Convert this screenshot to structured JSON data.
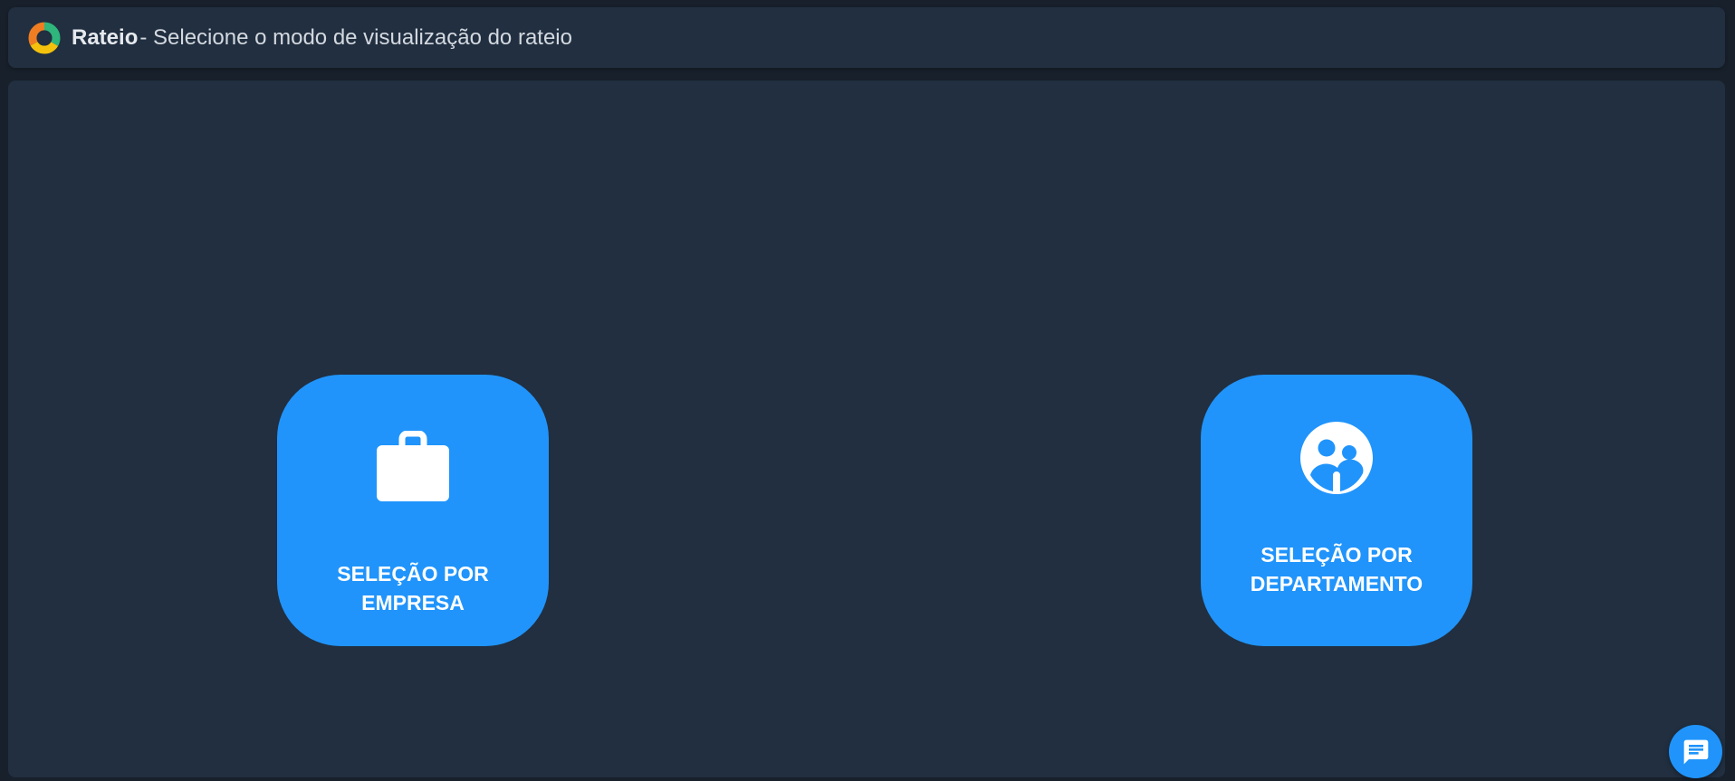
{
  "header": {
    "app_name": "Rateio",
    "subtitle": "- Selecione o modo de visualização do rateio",
    "logo_icon": "donut-logo-icon"
  },
  "options": [
    {
      "label": "SELEÇÃO POR EMPRESA",
      "icon": "briefcase-icon"
    },
    {
      "label": "SELEÇÃO POR DEPARTAMENTO",
      "icon": "group-icon"
    }
  ],
  "chat": {
    "icon": "chat-icon"
  },
  "colors": {
    "background": "#18202b",
    "panel": "#212f40",
    "accent": "#2094fb",
    "text": "#ffffff"
  }
}
